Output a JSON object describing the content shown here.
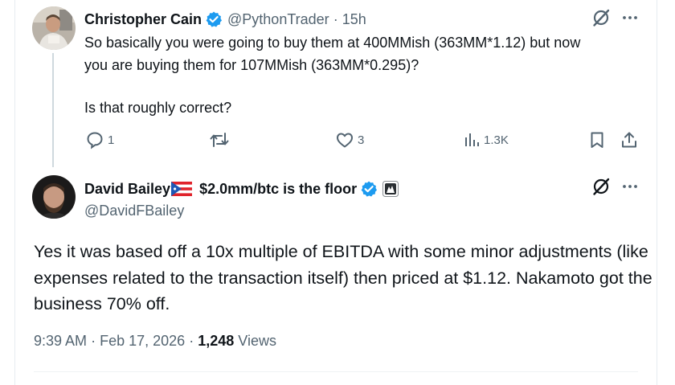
{
  "reply": {
    "author_name": "Christopher Cain",
    "author_handle": "@PythonTrader",
    "separator": "·",
    "time_ago": "15h",
    "text_line1": "So basically you were going to buy them at 400MMish (363MM*1.12) but now",
    "text_line2": "you are buying them for 107MMish (363MM*0.295)?",
    "text_line3": "Is that roughly correct?",
    "replies_count": "1",
    "reposts_count": "",
    "likes_count": "3",
    "views_count": "1.3K"
  },
  "main": {
    "author_name": "David Bailey",
    "author_name_suffix": "$2.0mm/btc is the floor",
    "author_handle": "@DavidFBailey",
    "text": "Yes it was based off a 10x multiple of EBITDA with some minor adjustments (like expenses related to the transaction itself) then priced at $1.12. Nakamoto got the business 70% off.",
    "time": "9:39 AM",
    "date_separator": "·",
    "date": "Feb 17, 2026",
    "views_separator": "·",
    "views_number": "1,248",
    "views_label": "Views"
  },
  "icons": {
    "verified": "verified-badge-icon",
    "flag": "puerto-rico-flag-icon",
    "affiliate": "affiliate-badge-icon",
    "grok": "grok-icon",
    "more": "more-icon",
    "reply": "reply-icon",
    "repost": "repost-icon",
    "like": "like-icon",
    "views": "views-icon",
    "bookmark": "bookmark-icon",
    "share": "share-icon"
  },
  "colors": {
    "text": "#0f1419",
    "secondary": "#536471",
    "verified": "#1d9bf0",
    "thread_line": "#cfd9de"
  }
}
